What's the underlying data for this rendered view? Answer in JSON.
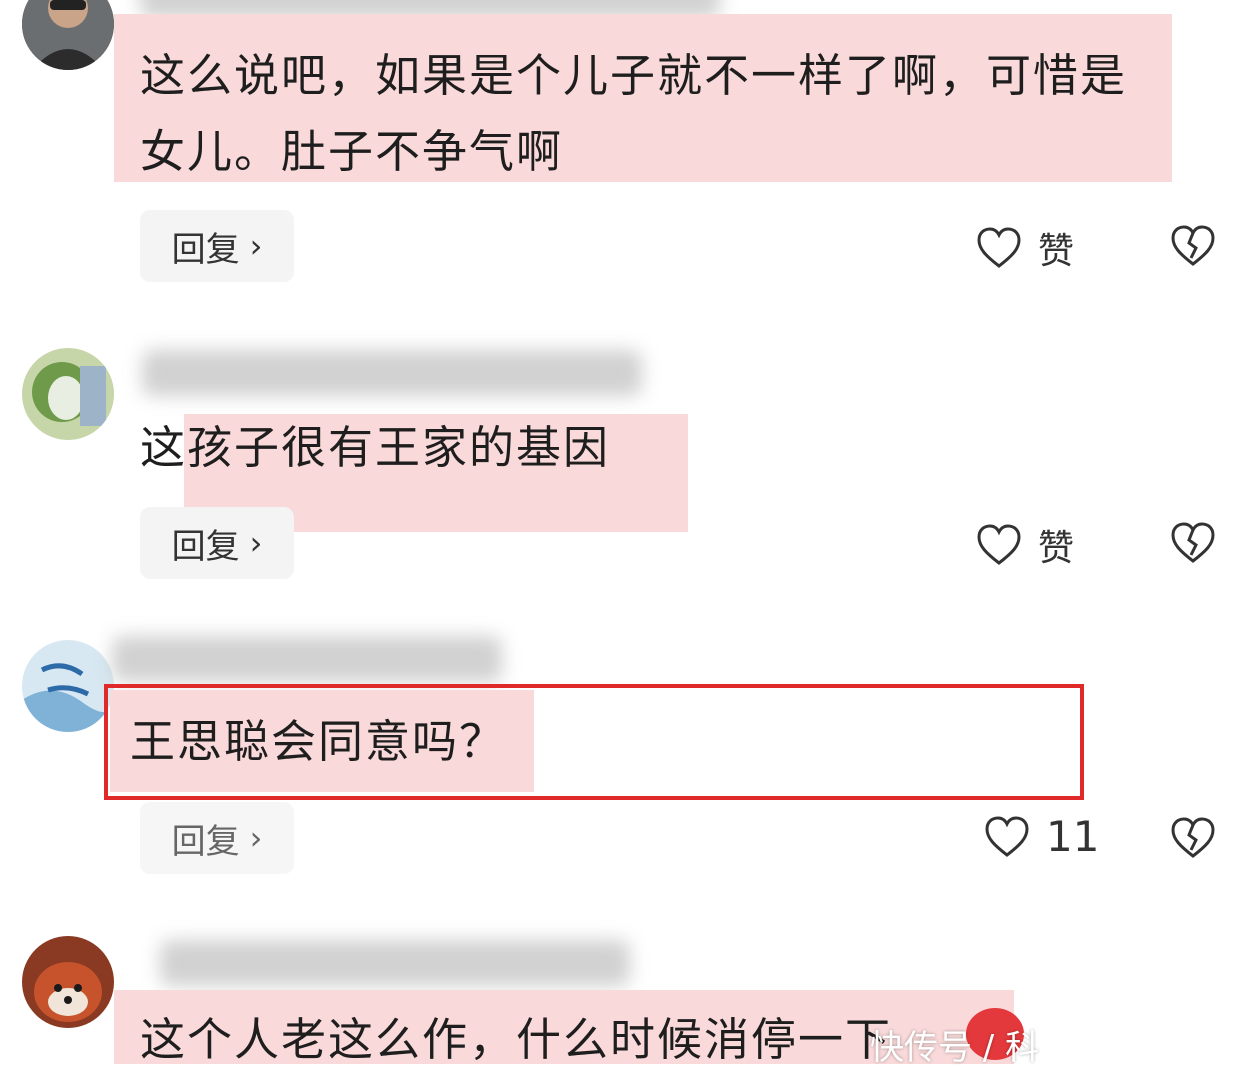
{
  "comments": [
    {
      "text_line1": "这么说吧，如果是个儿子就不一样了啊，可惜是",
      "text_line2": "女儿。肚子不争气啊",
      "reply_label": "回复",
      "like_label": "赞"
    },
    {
      "text_line1": "这孩子很有王家的基因",
      "reply_label": "回复",
      "like_label": "赞"
    },
    {
      "text_line1": "王思聪会同意吗？",
      "reply_label": "回复",
      "like_label": "11"
    },
    {
      "text_line1": "这个人老这么作，什么时候消停一下"
    }
  ],
  "watermark": {
    "text": "快传号 / 科"
  },
  "colors": {
    "highlight": "#f9d9d9",
    "red_box": "#e02a2a"
  },
  "icons": [
    "chevron-right-icon",
    "heart-icon",
    "broken-heart-icon"
  ]
}
